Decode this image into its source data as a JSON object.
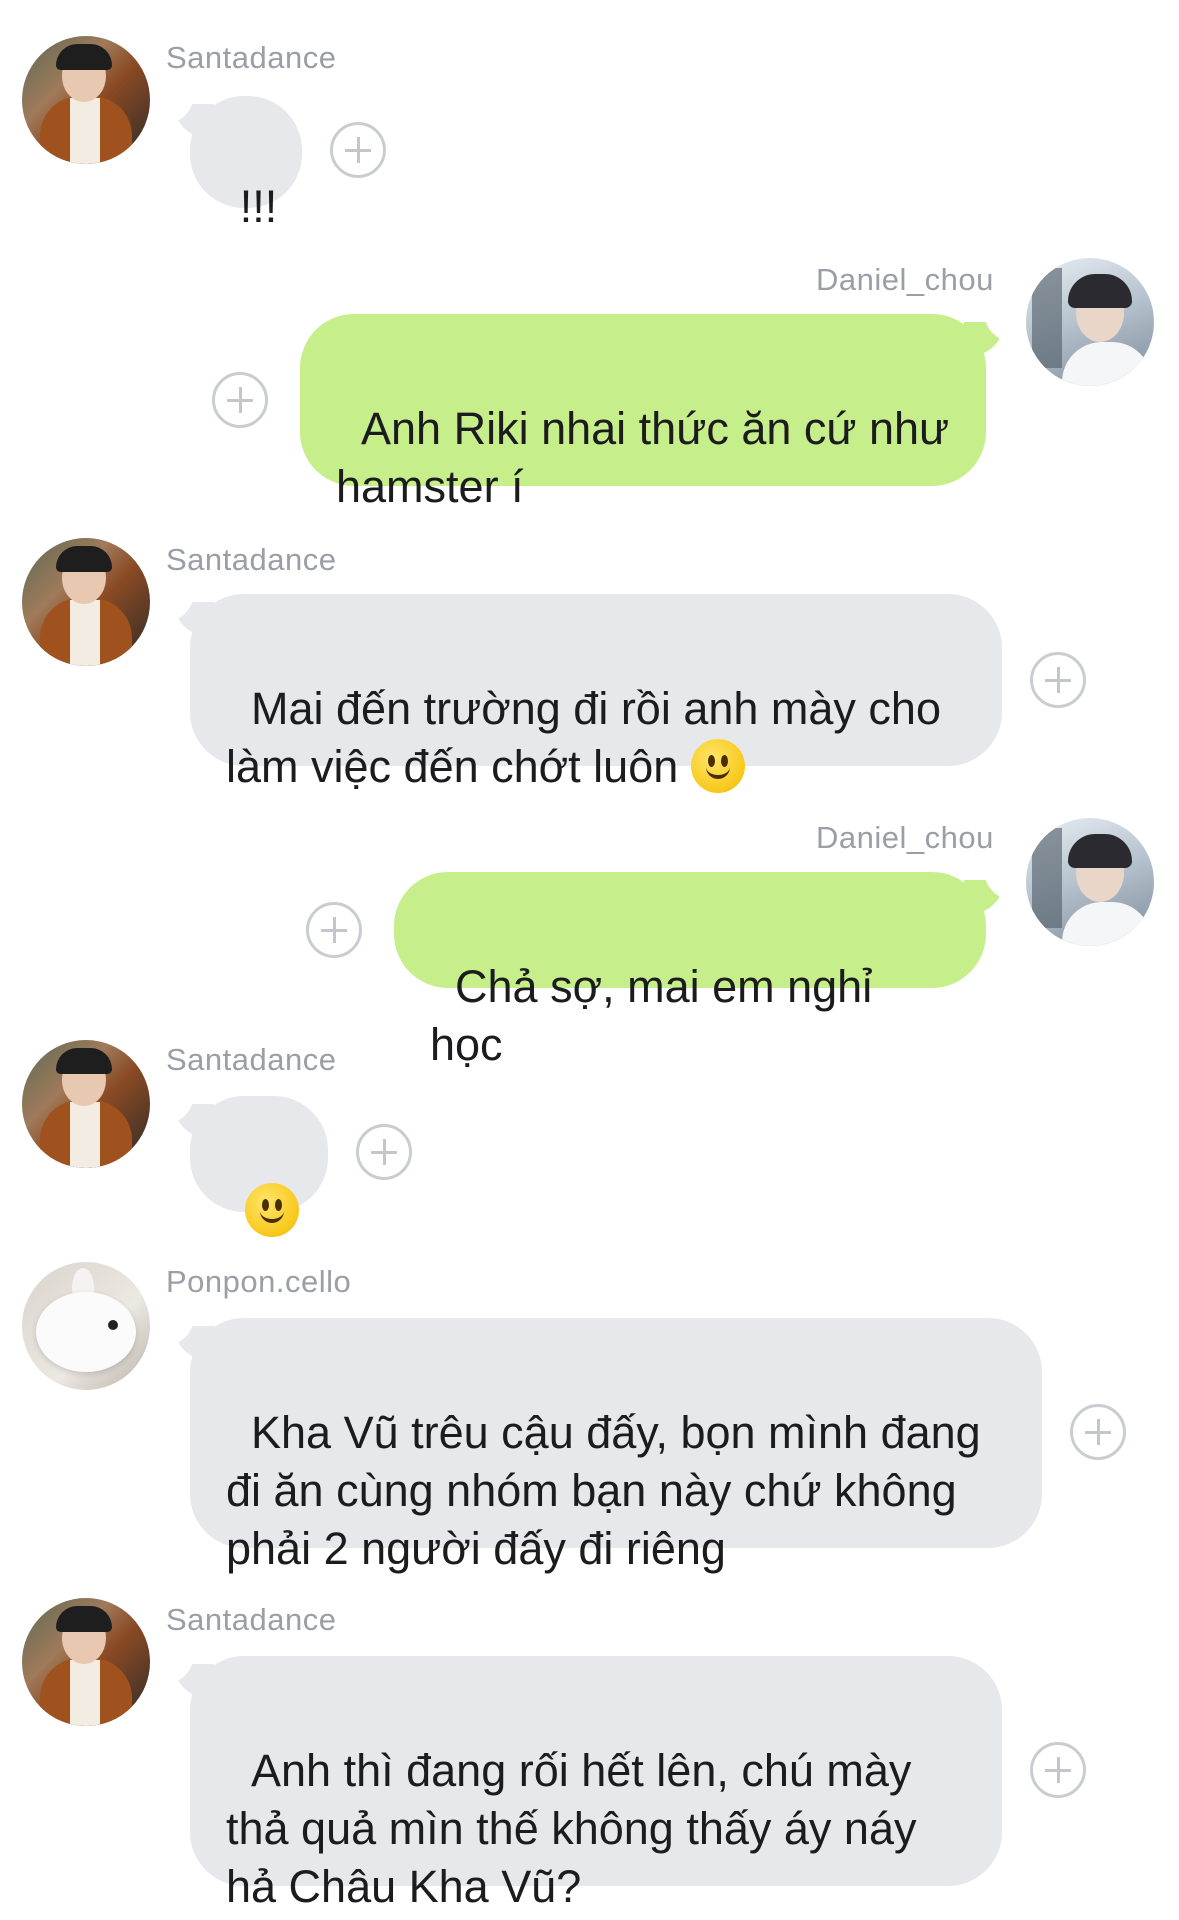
{
  "messages": [
    {
      "sender": "Santadance",
      "text": "!!!",
      "side": "in"
    },
    {
      "sender": "Daniel_chou",
      "text": "Anh Riki nhai thức ăn cứ như hamster í",
      "side": "out"
    },
    {
      "sender": "Santadance",
      "text": "Mai đến trường đi rồi anh mày cho làm việc đến chớt luôn",
      "emoji": "slightly-smiling-face",
      "side": "in"
    },
    {
      "sender": "Daniel_chou",
      "text": "Chả sợ, mai em nghỉ học",
      "side": "out"
    },
    {
      "sender": "Santadance",
      "text": "",
      "emoji": "slightly-smiling-face",
      "side": "in"
    },
    {
      "sender": "Ponpon.cello",
      "text": "Kha Vũ trêu cậu đấy, bọn mình đang đi ăn cùng nhóm bạn này chứ không phải 2 người đấy đi riêng",
      "side": "in"
    },
    {
      "sender": "Santadance",
      "text": "Anh thì đang rối hết lên, chú mày thả quả mìn thế không thấy áy náy hả Châu Kha Vũ?",
      "side": "in"
    }
  ],
  "colors": {
    "incoming_bubble": "#e6e8ec",
    "outgoing_bubble": "#c6ef8c",
    "sender_name": "#9a9ea6",
    "add_reaction_icon": "#c9ccd1"
  },
  "icons": [
    "add-reaction-icon",
    "slightly-smiling-face-emoji"
  ]
}
